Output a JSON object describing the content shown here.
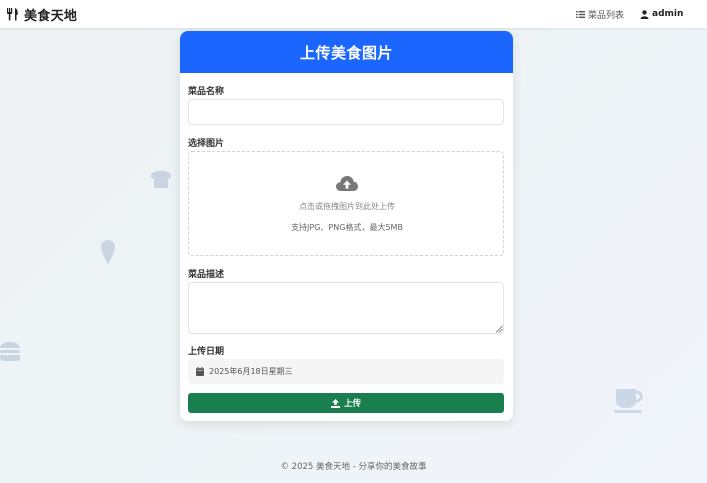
{
  "navbar": {
    "brand": "美食天地",
    "brand_icon": "utensils-icon",
    "links": [
      {
        "label": "菜品列表",
        "icon": "list-icon"
      },
      {
        "label": "admin",
        "icon": "user-icon"
      }
    ]
  },
  "form": {
    "title": "上传美食图片",
    "name_label": "菜品名称",
    "name_value": "",
    "image_label": "选择图片",
    "dropzone_hint": "点击或拖拽图片到此处上传",
    "dropzone_formats": "支持JPG、PNG格式，最大5MB",
    "dropzone_icon": "cloud-upload-icon",
    "description_label": "菜品描述",
    "description_value": "",
    "date_label": "上传日期",
    "date_value": "2025年6月18日星期三",
    "date_icon": "calendar-icon",
    "submit_label": "上传",
    "submit_icon": "upload-icon"
  },
  "footer": "© 2025 美食天地 - 分享你的美食故事",
  "colors": {
    "header_blue": "#1a66ff",
    "submit_green": "#1a7f4e",
    "decor_icon_blue": "#5b7fb5"
  },
  "decorations": [
    "bread-icon",
    "ice-cream-icon",
    "burger-icon",
    "coffee-cup-icon"
  ]
}
